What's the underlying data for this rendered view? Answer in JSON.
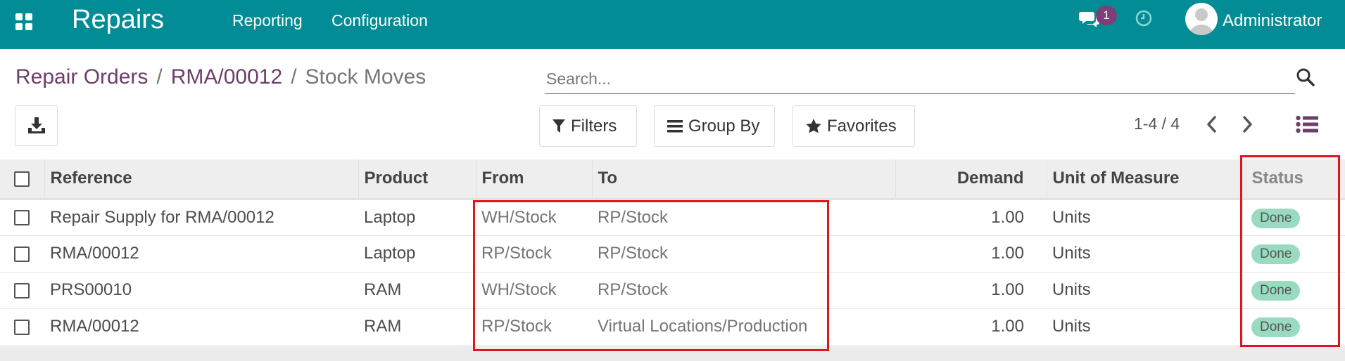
{
  "navbar": {
    "brand": "Repairs",
    "menu": [
      "Reporting",
      "Configuration"
    ],
    "chat_count": "1",
    "user": "Administrator",
    "bg_color": "#028c95"
  },
  "breadcrumb": {
    "items": [
      "Repair Orders",
      "RMA/00012"
    ],
    "separator": "/",
    "current": "Stock Moves"
  },
  "search": {
    "placeholder": "Search..."
  },
  "toolbar": {
    "filters": "Filters",
    "group_by": "Group By",
    "favorites": "Favorites",
    "pager": "1-4 / 4"
  },
  "table": {
    "columns": [
      "Reference",
      "Product",
      "From",
      "To",
      "Demand",
      "Unit of Measure",
      "Status"
    ],
    "rows": [
      {
        "reference": "Repair Supply for RMA/00012",
        "product": "Laptop",
        "from": "WH/Stock",
        "to": "RP/Stock",
        "demand": "1.00",
        "uom": "Units",
        "status": "Done"
      },
      {
        "reference": "RMA/00012",
        "product": "Laptop",
        "from": "RP/Stock",
        "to": "RP/Stock",
        "demand": "1.00",
        "uom": "Units",
        "status": "Done"
      },
      {
        "reference": "PRS00010",
        "product": "RAM",
        "from": "WH/Stock",
        "to": "RP/Stock",
        "demand": "1.00",
        "uom": "Units",
        "status": "Done"
      },
      {
        "reference": "RMA/00012",
        "product": "RAM",
        "from": "RP/Stock",
        "to": "Virtual Locations/Production",
        "demand": "1.00",
        "uom": "Units",
        "status": "Done"
      }
    ]
  },
  "colors": {
    "accent": "#028c95",
    "breadcrumb_link": "#6d3e6b",
    "badge_done": "#99dbc1",
    "highlight": "#e0141e"
  },
  "icons": [
    "apps-grid-icon",
    "chat-icon",
    "clock-icon",
    "avatar-icon",
    "search-icon",
    "download-icon",
    "filter-icon",
    "list-lines-icon",
    "star-icon",
    "chevron-left-icon",
    "chevron-right-icon",
    "list-view-icon"
  ]
}
